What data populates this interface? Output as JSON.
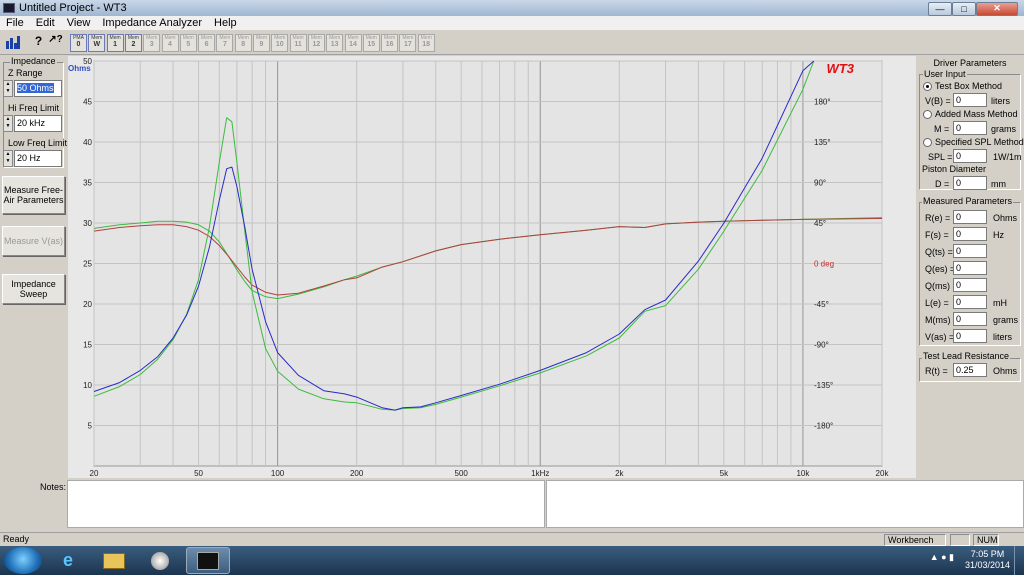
{
  "window": {
    "title": "Untitled Project - WT3"
  },
  "menu": [
    "File",
    "Edit",
    "View",
    "Impedance Analyzer",
    "Help"
  ],
  "toolbar": {
    "memory_buttons": [
      {
        "t": "PMA",
        "n": "0"
      },
      {
        "t": "Mem",
        "n": "W"
      },
      {
        "t": "Mem",
        "n": "1"
      },
      {
        "t": "Mem",
        "n": "2"
      },
      {
        "t": "Mem",
        "n": "3"
      },
      {
        "t": "Mem",
        "n": "4"
      },
      {
        "t": "Mem",
        "n": "5"
      },
      {
        "t": "Mem",
        "n": "6"
      },
      {
        "t": "Mem",
        "n": "7"
      },
      {
        "t": "Mem",
        "n": "8"
      },
      {
        "t": "Mem",
        "n": "9"
      },
      {
        "t": "Mem",
        "n": "10"
      },
      {
        "t": "Mem",
        "n": "11"
      },
      {
        "t": "Mem",
        "n": "12"
      },
      {
        "t": "Mem",
        "n": "13"
      },
      {
        "t": "Mem",
        "n": "14"
      },
      {
        "t": "Mem",
        "n": "15"
      },
      {
        "t": "Mem",
        "n": "16"
      },
      {
        "t": "Mem",
        "n": "17"
      },
      {
        "t": "Mem",
        "n": "18"
      }
    ]
  },
  "left_panel": {
    "impedance_label": "Impedance",
    "z_range_label": "Z Range",
    "z_range_value": "50 Ohms",
    "hi_freq_label": "Hi Freq Limit",
    "hi_freq_value": "20 kHz",
    "low_freq_label": "Low Freq Limit",
    "low_freq_value": "20 Hz",
    "measure_free_air": "Measure Free-Air Parameters",
    "measure_vas": "Measure V(as)",
    "impedance_sweep": "Impedance Sweep"
  },
  "right_panel": {
    "title": "Driver Parameters",
    "user_input_label": "User Input",
    "test_box_method": "Test Box Method",
    "vb_label": "V(B) =",
    "vb_value": "0",
    "vb_unit": "liters",
    "added_mass_method": "Added Mass Method",
    "m_label": "M =",
    "m_value": "0",
    "m_unit": "grams",
    "specified_spl_method": "Specified SPL Method",
    "spl_label": "SPL =",
    "spl_value": "0",
    "spl_unit": "1W/1m",
    "piston_diameter_label": "Piston Diameter",
    "d_label": "D =",
    "d_value": "0",
    "d_unit": "mm",
    "measured_label": "Measured Parameters",
    "measured": [
      {
        "label": "R(e) =",
        "value": "0",
        "unit": "Ohms"
      },
      {
        "label": "F(s) =",
        "value": "0",
        "unit": "Hz"
      },
      {
        "label": "Q(ts) =",
        "value": "0",
        "unit": ""
      },
      {
        "label": "Q(es) =",
        "value": "0",
        "unit": ""
      },
      {
        "label": "Q(ms) =",
        "value": "0",
        "unit": ""
      },
      {
        "label": "L(e) =",
        "value": "0",
        "unit": "mH"
      },
      {
        "label": "M(ms) =",
        "value": "0",
        "unit": "grams"
      },
      {
        "label": "V(as) =",
        "value": "0",
        "unit": "liters"
      }
    ],
    "test_lead_label": "Test Lead Resistance",
    "rt_label": "R(t) =",
    "rt_value": "0.25",
    "rt_unit": "Ohms"
  },
  "notes": {
    "label": "Notes:"
  },
  "status": {
    "left": "Ready",
    "workbench": "Workbench",
    "num": "NUM"
  },
  "taskbar": {
    "time": "7:05 PM",
    "date": "31/03/2014"
  },
  "chart_data": {
    "type": "line",
    "title": "WT3",
    "ylabel": "Ohms",
    "x_scale": "log",
    "xlim": [
      20,
      20000
    ],
    "ylim": [
      0,
      50
    ],
    "y2lim": [
      -225,
      225
    ],
    "y2_unit": "deg",
    "x_ticks": [
      20,
      50,
      100,
      200,
      500,
      1000,
      2000,
      5000,
      10000,
      20000
    ],
    "x_tick_labels": [
      "20",
      "50",
      "100",
      "200",
      "500",
      "1kHz",
      "2k",
      "5k",
      "10k",
      "20k"
    ],
    "y_ticks": [
      5,
      10,
      15,
      20,
      25,
      30,
      35,
      40,
      45,
      50
    ],
    "y2_ticks": [
      -180,
      -135,
      -90,
      -45,
      0,
      45,
      90,
      135,
      180
    ],
    "y2_tick_labels": [
      "-180°",
      "-135°",
      "-90°",
      "-45°",
      "0 deg",
      "45°",
      "90°",
      "135°",
      "180°"
    ],
    "grid": true,
    "colors": {
      "impedance_blue": "#2a2ac8",
      "impedance_green": "#3dbb3d",
      "phase_red": "#b04040",
      "phase_green": "#3dbb3d",
      "ylabel_blue": "#3050c0",
      "y2label_red": "#c03030",
      "title_red": "#e01010"
    },
    "series": [
      {
        "axis": "y",
        "x": [
          20,
          25,
          30,
          35,
          40,
          45,
          50,
          55,
          60,
          64,
          67,
          70,
          75,
          80,
          90,
          100,
          120,
          150,
          180,
          200,
          250,
          280,
          300,
          350,
          400,
          500,
          700,
          1000,
          1500,
          2000,
          2500,
          3000,
          4000,
          5000,
          7000,
          10000,
          11000
        ],
        "values": [
          9.2,
          10.3,
          11.8,
          13.5,
          15.8,
          18.6,
          22.2,
          27.0,
          32.8,
          36.7,
          36.9,
          34.5,
          29.5,
          24.3,
          17.8,
          14.0,
          11.2,
          9.3,
          8.9,
          8.5,
          7.2,
          6.9,
          7.2,
          7.3,
          7.8,
          8.7,
          10.1,
          11.8,
          14.0,
          16.3,
          19.3,
          20.5,
          25.3,
          30.0,
          38.0,
          48.8,
          50
        ]
      },
      {
        "axis": "y",
        "x": [
          20,
          25,
          30,
          35,
          40,
          45,
          50,
          55,
          60,
          64,
          67,
          70,
          75,
          80,
          90,
          100,
          120,
          150,
          180,
          200,
          250,
          280,
          300,
          350,
          400,
          500,
          700,
          1000,
          1500,
          2000,
          2500,
          3000,
          4000,
          5000,
          7000,
          10000,
          11000
        ],
        "values": [
          8.6,
          9.8,
          11.3,
          13.2,
          15.6,
          18.7,
          23.0,
          29.5,
          37.5,
          43.0,
          42.5,
          37.5,
          29.0,
          21.5,
          14.5,
          11.7,
          9.5,
          8.3,
          7.9,
          7.8,
          7.0,
          6.9,
          7.1,
          7.2,
          7.6,
          8.5,
          9.9,
          11.5,
          13.6,
          15.8,
          19.1,
          19.8,
          24.3,
          29.0,
          36.5,
          46.5,
          50
        ]
      },
      {
        "axis": "y2",
        "x": [
          20,
          25,
          30,
          35,
          40,
          45,
          50,
          55,
          60,
          65,
          70,
          75,
          80,
          90,
          100,
          120,
          150,
          180,
          200,
          250,
          300,
          400,
          500,
          700,
          1000,
          1500,
          2000,
          2500,
          3000,
          4000,
          5000,
          7000,
          10000,
          20000
        ],
        "values": [
          36,
          40,
          42,
          43,
          43,
          41,
          37,
          30,
          20,
          8,
          -4,
          -15,
          -24,
          -32,
          -35,
          -33,
          -25,
          -18,
          -16,
          -4,
          2,
          14,
          21,
          27,
          32,
          37,
          41,
          40,
          44,
          46,
          47,
          48,
          49,
          50
        ]
      },
      {
        "axis": "y2",
        "x": [
          20,
          25,
          30,
          35,
          40,
          45,
          50,
          55,
          60,
          65,
          70,
          75,
          80,
          90,
          100,
          120,
          150,
          180,
          200,
          250,
          300,
          400,
          500,
          700,
          1000,
          1500,
          2000,
          2500,
          3000,
          4000,
          5000,
          7000,
          10000,
          20000
        ],
        "values": [
          39,
          43,
          45,
          47,
          47,
          46,
          43,
          36,
          24,
          8,
          -7,
          -20,
          -30,
          -37,
          -39,
          -34,
          -26,
          -18,
          -14,
          -4,
          2,
          14,
          21,
          27,
          32,
          37,
          41,
          40,
          44,
          46,
          47,
          48,
          49,
          51
        ]
      }
    ]
  }
}
